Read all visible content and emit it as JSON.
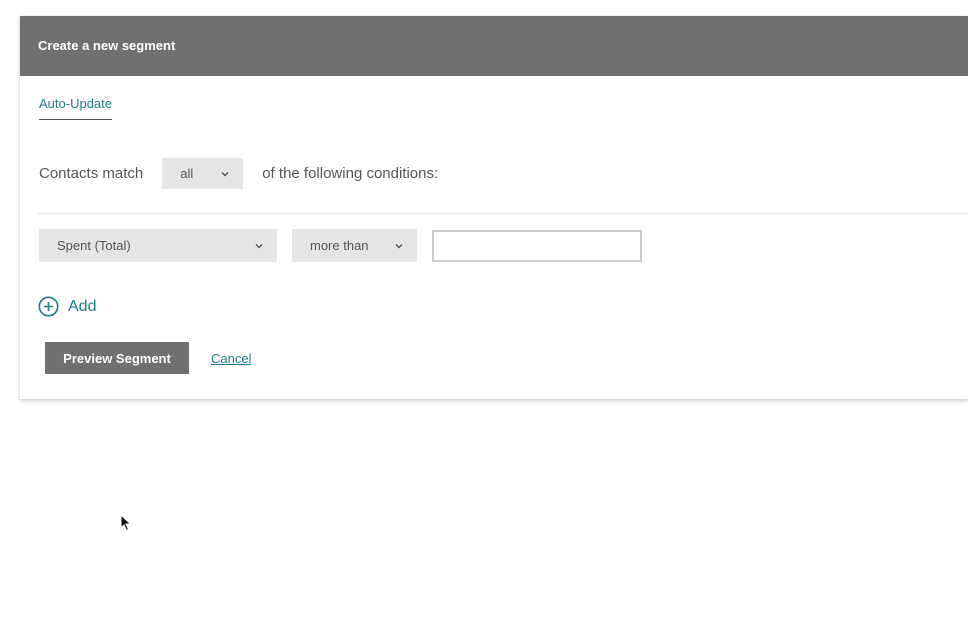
{
  "header": {
    "title": "Create a new segment"
  },
  "tabs": [
    {
      "label": "Auto-Update",
      "active": true
    }
  ],
  "match": {
    "prefix": "Contacts match",
    "selected": "all",
    "suffix": "of the following conditions:"
  },
  "condition": {
    "field": "Spent (Total)",
    "operator": "more than",
    "value": ""
  },
  "add": {
    "label": "Add"
  },
  "actions": {
    "preview_label": "Preview Segment",
    "cancel_label": "Cancel"
  },
  "colors": {
    "header_bg": "#707070",
    "accent": "#1c7d86",
    "select_bg": "#e5e5e5"
  },
  "icons": {
    "add": "plus-circle-icon",
    "chevron": "chevron-down-icon",
    "cursor": "mouse-pointer-icon"
  }
}
